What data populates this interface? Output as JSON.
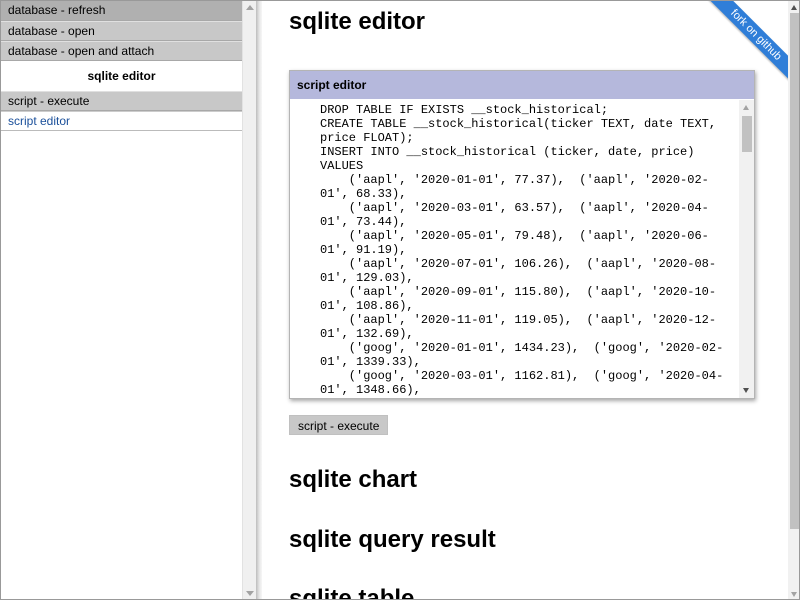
{
  "sidebar": {
    "buttons": [
      "database - refresh",
      "database - open",
      "database - open and attach"
    ],
    "section_title": "sqlite editor",
    "execute_label": "script - execute",
    "link_label": "script editor"
  },
  "main": {
    "title": "sqlite editor",
    "editor": {
      "header": "script editor",
      "script_lines": [
        "DROP TABLE IF EXISTS __stock_historical;",
        "CREATE TABLE __stock_historical(ticker TEXT, date TEXT,",
        "price FLOAT);",
        "INSERT INTO __stock_historical (ticker, date, price)",
        "VALUES",
        "    ('aapl', '2020-01-01', 77.37),  ('aapl', '2020-02-",
        "01', 68.33),",
        "    ('aapl', '2020-03-01', 63.57),  ('aapl', '2020-04-",
        "01', 73.44),",
        "    ('aapl', '2020-05-01', 79.48),  ('aapl', '2020-06-",
        "01', 91.19),",
        "    ('aapl', '2020-07-01', 106.26),  ('aapl', '2020-08-",
        "01', 129.03),",
        "    ('aapl', '2020-09-01', 115.80),  ('aapl', '2020-10-",
        "01', 108.86),",
        "    ('aapl', '2020-11-01', 119.05),  ('aapl', '2020-12-",
        "01', 132.69),",
        "    ('goog', '2020-01-01', 1434.23),  ('goog', '2020-02-",
        "01', 1339.33),",
        "    ('goog', '2020-03-01', 1162.81),  ('goog', '2020-04-",
        "01', 1348.66),"
      ]
    },
    "execute_label": "script - execute",
    "chart_title": "sqlite chart",
    "result_title": "sqlite query result",
    "table_title": "sqlite table"
  },
  "ribbon": {
    "label": "fork on github",
    "color": "#2f7ed8"
  }
}
